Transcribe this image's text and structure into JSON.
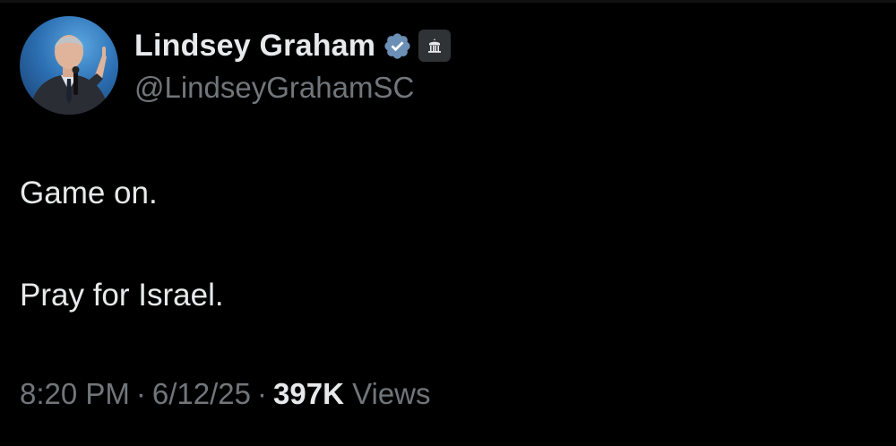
{
  "author": {
    "display_name": "Lindsey Graham",
    "handle": "@LindseyGrahamSC",
    "verified_icon": "verified-badge-icon",
    "affiliation_icon": "government-building-icon",
    "avatar": "profile-photo"
  },
  "tweet": {
    "line_1": "Game on.",
    "line_2": "Pray for Israel."
  },
  "meta": {
    "time": "8:20 PM",
    "separator": "·",
    "date": "6/12/25",
    "views_count": "397K",
    "views_label": "Views"
  },
  "colors": {
    "background": "#000000",
    "primary_text": "#e7e9ea",
    "secondary_text": "#71767b",
    "verified_blue": "#1d9bf0",
    "badge_bg": "#2f3336"
  }
}
